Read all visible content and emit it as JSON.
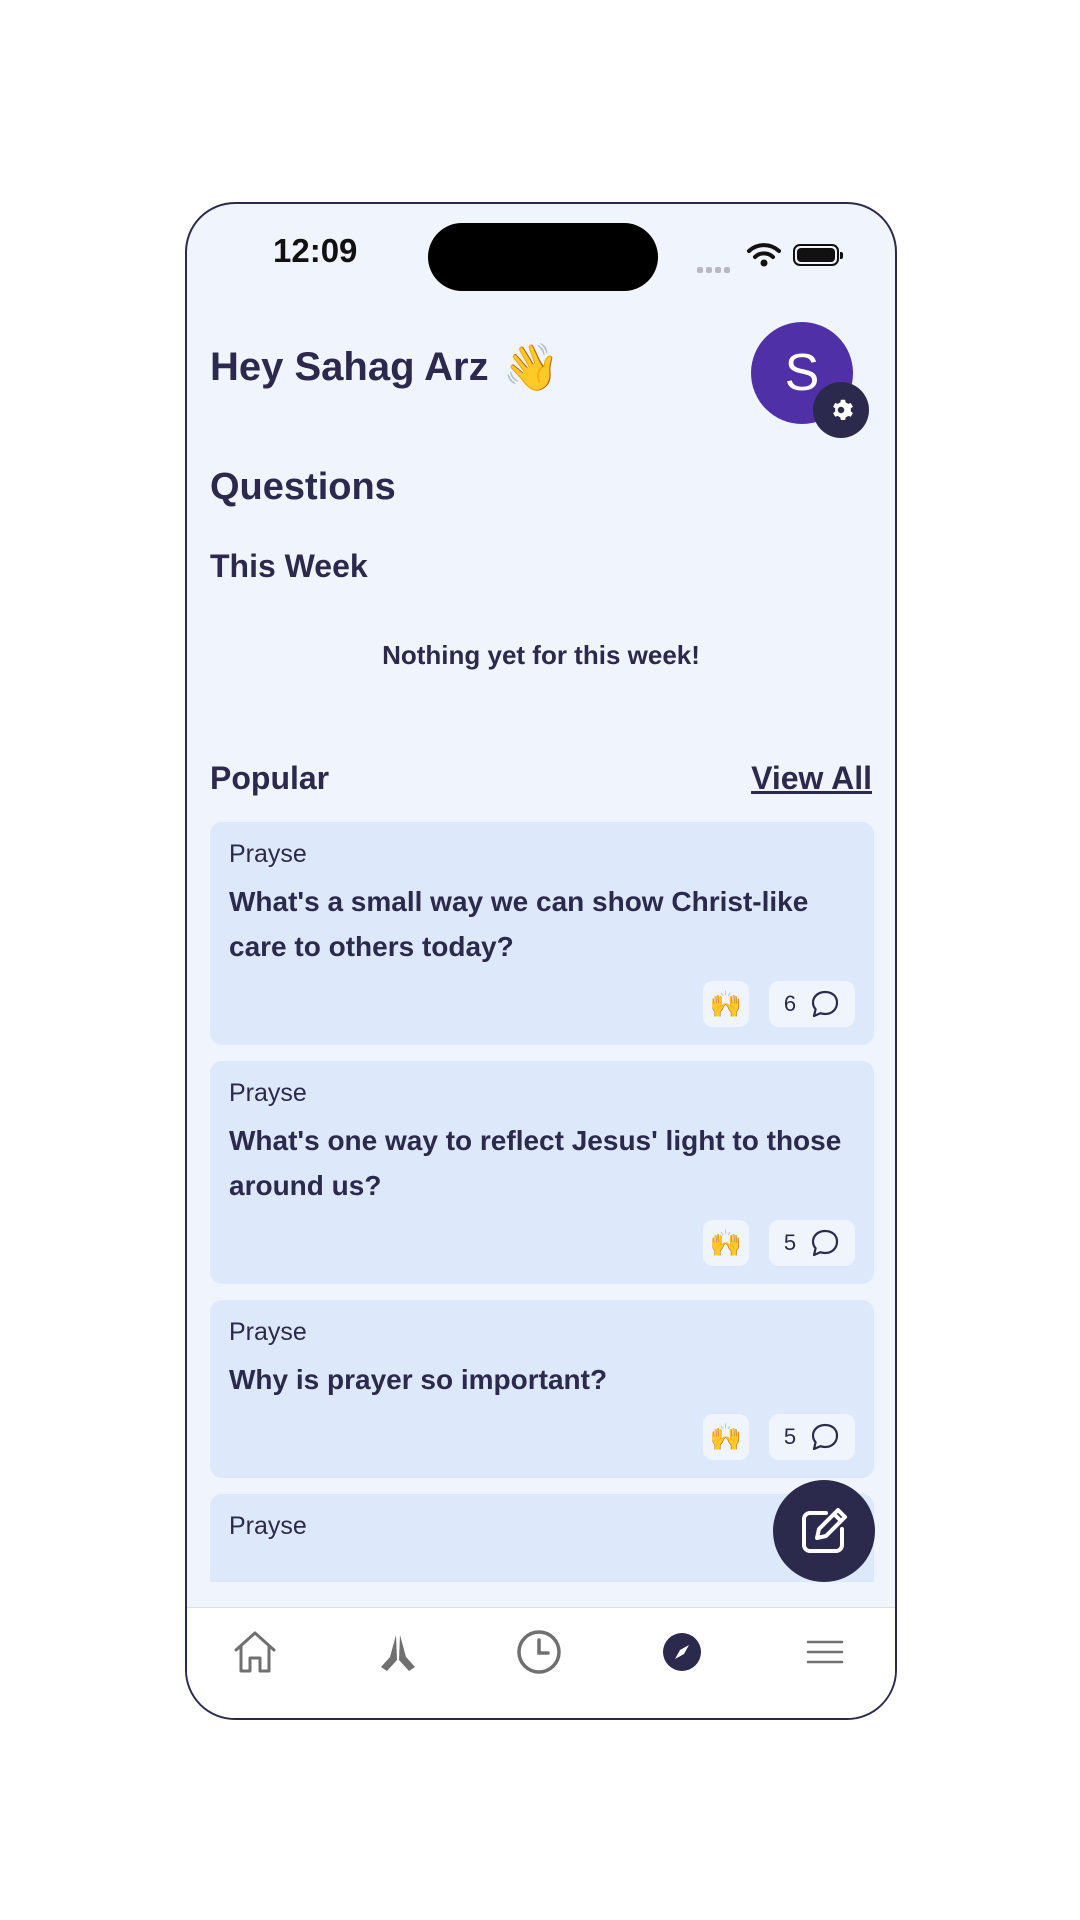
{
  "status_bar": {
    "time": "12:09"
  },
  "header": {
    "greeting": "Hey Sahag Arz",
    "wave_emoji": "👋",
    "avatar_initial": "S"
  },
  "sections": {
    "questions_title": "Questions",
    "this_week_title": "This Week",
    "this_week_empty": "Nothing yet for this week!",
    "popular_title": "Popular",
    "view_all_label": "View All"
  },
  "popular": [
    {
      "source": "Prayse",
      "question": "What's a small way we can show Christ-like care to others today?",
      "reaction": "🙌",
      "comment_count": "6"
    },
    {
      "source": "Prayse",
      "question": "What's one way to reflect Jesus' light to those around us?",
      "reaction": "🙌",
      "comment_count": "5"
    },
    {
      "source": "Prayse",
      "question": "Why is prayer so important?",
      "reaction": "🙌",
      "comment_count": "5"
    },
    {
      "source": "Prayse",
      "question": "",
      "reaction": "",
      "comment_count": ""
    }
  ],
  "tabs": [
    {
      "icon": "home-icon",
      "active": false
    },
    {
      "icon": "praying-hands-icon",
      "active": false
    },
    {
      "icon": "clock-icon",
      "active": false
    },
    {
      "icon": "compass-icon",
      "active": true
    },
    {
      "icon": "menu-icon",
      "active": false
    }
  ],
  "colors": {
    "primary": "#2b2a4c",
    "avatar": "#5030a6",
    "background": "#f0f5fd",
    "card": "#dde8fb"
  }
}
